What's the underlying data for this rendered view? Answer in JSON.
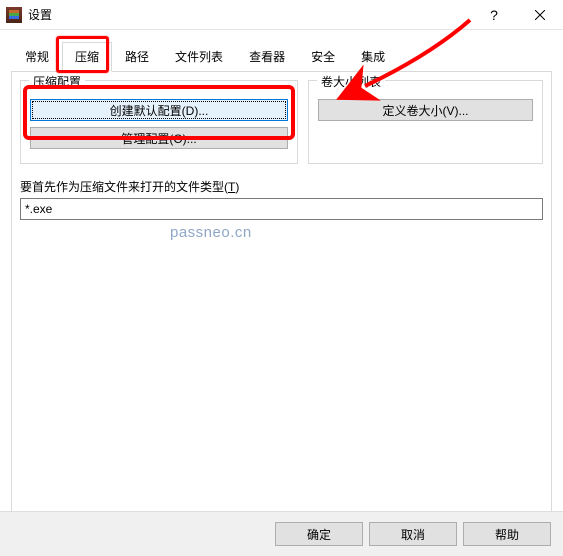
{
  "window": {
    "title": "设置"
  },
  "tabs": {
    "general": "常规",
    "compress": "压缩",
    "path": "路径",
    "filelist": "文件列表",
    "viewer": "查看器",
    "security": "安全",
    "integrate": "集成"
  },
  "group_compress": {
    "title": "压缩配置",
    "create_default": "创建默认配置(D)...",
    "manage": "管理配置(O)..."
  },
  "group_volume": {
    "title": "卷大小列表",
    "define": "定义卷大小(V)..."
  },
  "filetype": {
    "label_prefix": "要首先作为压缩文件来打开的文件类型(",
    "label_key": "T",
    "label_suffix": ")",
    "value": "*.exe"
  },
  "dlg": {
    "ok": "确定",
    "cancel": "取消",
    "help": "帮助"
  },
  "watermark": "passneo.cn"
}
